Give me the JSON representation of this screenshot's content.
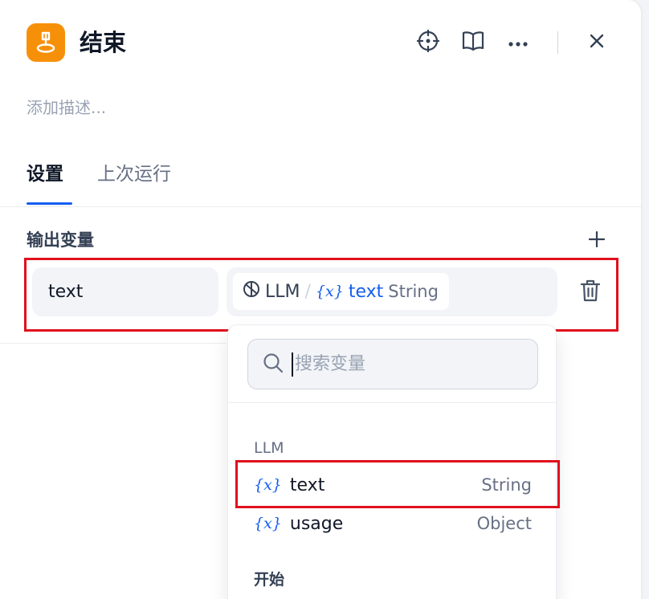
{
  "header": {
    "title": "结束",
    "icons": [
      "end-node-icon",
      "locate-icon",
      "book-icon",
      "more-icon",
      "close-icon"
    ]
  },
  "description": {
    "placeholder": "添加描述..."
  },
  "tabs": [
    {
      "label": "设置",
      "active": true
    },
    {
      "label": "上次运行",
      "active": false
    }
  ],
  "output": {
    "section_title": "输出变量",
    "variable": {
      "name": "text",
      "source_node": "LLM",
      "separator": "/",
      "var_symbol": "{x}",
      "var_name": "text",
      "var_type": "String"
    }
  },
  "dropdown": {
    "search_placeholder": "搜索变量",
    "groups": [
      {
        "label": "LLM",
        "items": [
          {
            "symbol": "{x}",
            "name": "text",
            "type": "String"
          },
          {
            "symbol": "{x}",
            "name": "usage",
            "type": "Object"
          }
        ]
      },
      {
        "label": "开始",
        "items": []
      }
    ]
  },
  "colors": {
    "accent": "#155eef",
    "node_icon": "#f79009",
    "highlight_outline": "#e0101d"
  }
}
